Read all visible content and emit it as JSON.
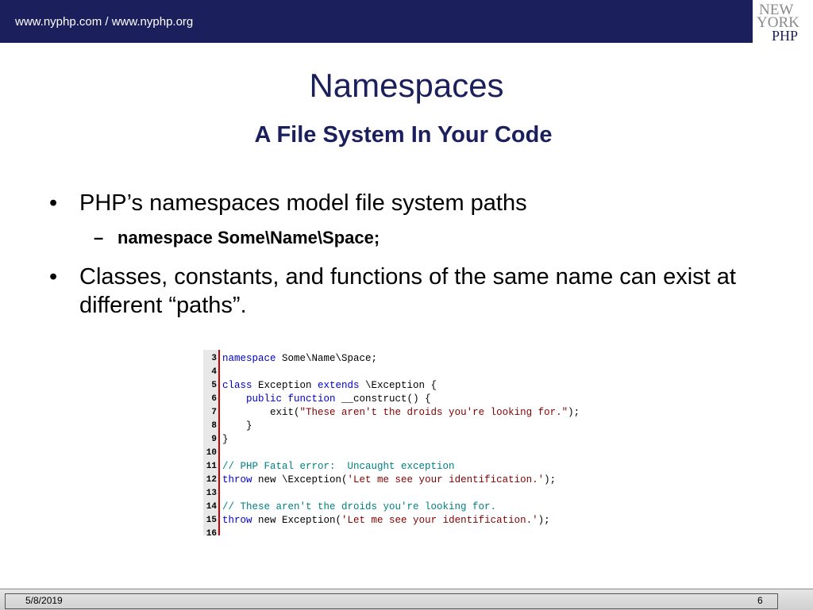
{
  "header": {
    "links": "www.nyphp.com  /  www.nyphp.org"
  },
  "logo": {
    "line1": "NEW",
    "line2": "YORK",
    "line3": "PHP"
  },
  "slide": {
    "title": "Namespaces",
    "subtitle": "A File System In Your Code",
    "bullet1": "PHP’s namespaces model file system paths",
    "sub1": "namespace Some\\Name\\Space;",
    "bullet2": "Classes, constants, and functions of the same name can exist at different “paths”."
  },
  "code": {
    "line_numbers": [
      "3",
      "4",
      "5",
      "6",
      "7",
      "8",
      "9",
      "10",
      "11",
      "12",
      "13",
      "14",
      "15",
      "16"
    ],
    "lines": [
      [
        {
          "t": "namespace",
          "c": "kw"
        },
        {
          "t": " Some\\Name\\Space;",
          "c": ""
        }
      ],
      [],
      [
        {
          "t": "class",
          "c": "kw"
        },
        {
          "t": " Exception ",
          "c": ""
        },
        {
          "t": "extends",
          "c": "kw"
        },
        {
          "t": " \\Exception {",
          "c": ""
        }
      ],
      [
        {
          "t": "    ",
          "c": ""
        },
        {
          "t": "public function",
          "c": "kw"
        },
        {
          "t": " __construct() {",
          "c": ""
        }
      ],
      [
        {
          "t": "        exit(",
          "c": ""
        },
        {
          "t": "\"These aren't the droids you're looking for.\"",
          "c": "str"
        },
        {
          "t": ");",
          "c": ""
        }
      ],
      [
        {
          "t": "    }",
          "c": ""
        }
      ],
      [
        {
          "t": "}",
          "c": ""
        }
      ],
      [],
      [
        {
          "t": "// PHP Fatal error:  Uncaught exception",
          "c": "cm"
        }
      ],
      [
        {
          "t": "throw",
          "c": "kw"
        },
        {
          "t": " new \\Exception(",
          "c": ""
        },
        {
          "t": "'Let me see your identification.'",
          "c": "str"
        },
        {
          "t": ");",
          "c": ""
        }
      ],
      [],
      [
        {
          "t": "// These aren't the droids you're looking for.",
          "c": "cm"
        }
      ],
      [
        {
          "t": "throw",
          "c": "kw"
        },
        {
          "t": " new Exception(",
          "c": ""
        },
        {
          "t": "'Let me see your identification.'",
          "c": "str"
        },
        {
          "t": ");",
          "c": ""
        }
      ],
      []
    ]
  },
  "footer": {
    "date": "5/8/2019",
    "page": "6"
  }
}
